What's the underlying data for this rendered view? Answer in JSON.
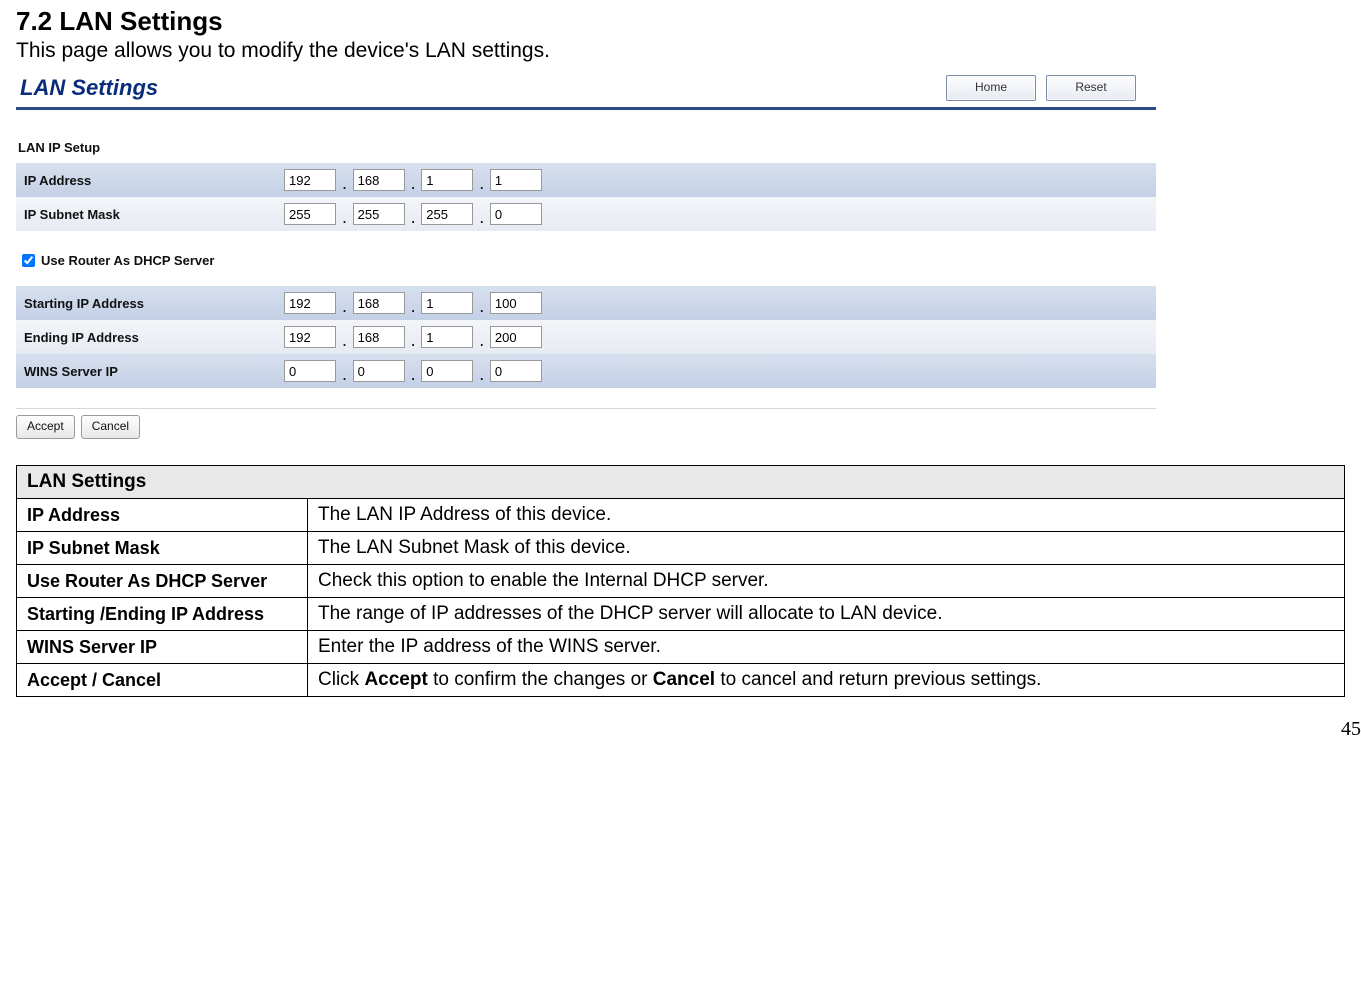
{
  "heading": "7.2   LAN Settings",
  "intro": "This page allows you to modify the device's LAN settings.",
  "shot": {
    "title": "LAN Settings",
    "btn_home": "Home",
    "btn_reset": "Reset",
    "sec1_label": "LAN IP Setup",
    "row_ipaddr_label": "IP Address",
    "row_subnet_label": "IP Subnet Mask",
    "ip_address": [
      "192",
      "168",
      "1",
      "1"
    ],
    "subnet": [
      "255",
      "255",
      "255",
      "0"
    ],
    "chk_label": "Use Router As DHCP Server",
    "row_start_label": "Starting IP Address",
    "row_end_label": "Ending IP Address",
    "row_wins_label": "WINS Server IP",
    "starting_ip": [
      "192",
      "168",
      "1",
      "100"
    ],
    "ending_ip": [
      "192",
      "168",
      "1",
      "200"
    ],
    "wins": [
      "0",
      "0",
      "0",
      "0"
    ],
    "btn_accept": "Accept",
    "btn_cancel": "Cancel"
  },
  "table": {
    "header": "LAN Settings",
    "rows": [
      {
        "k": "IP Address",
        "v": "The LAN IP Address of this device."
      },
      {
        "k": "IP Subnet Mask",
        "v": "The LAN Subnet Mask of this device."
      },
      {
        "k": "Use Router As DHCP Server",
        "v": "Check this option to enable the Internal DHCP server."
      },
      {
        "k": "Starting /Ending IP Address",
        "v": "The range of IP addresses of the DHCP server will allocate to LAN device."
      },
      {
        "k": "WINS Server IP",
        "v": "Enter the IP address of the WINS server."
      }
    ],
    "last_k": "Accept / Cancel",
    "last_pre": "Click ",
    "last_accept": "Accept",
    "last_mid": " to confirm the changes or ",
    "last_cancel": "Cancel",
    "last_post": " to cancel and return previous settings."
  },
  "page_number": "45"
}
